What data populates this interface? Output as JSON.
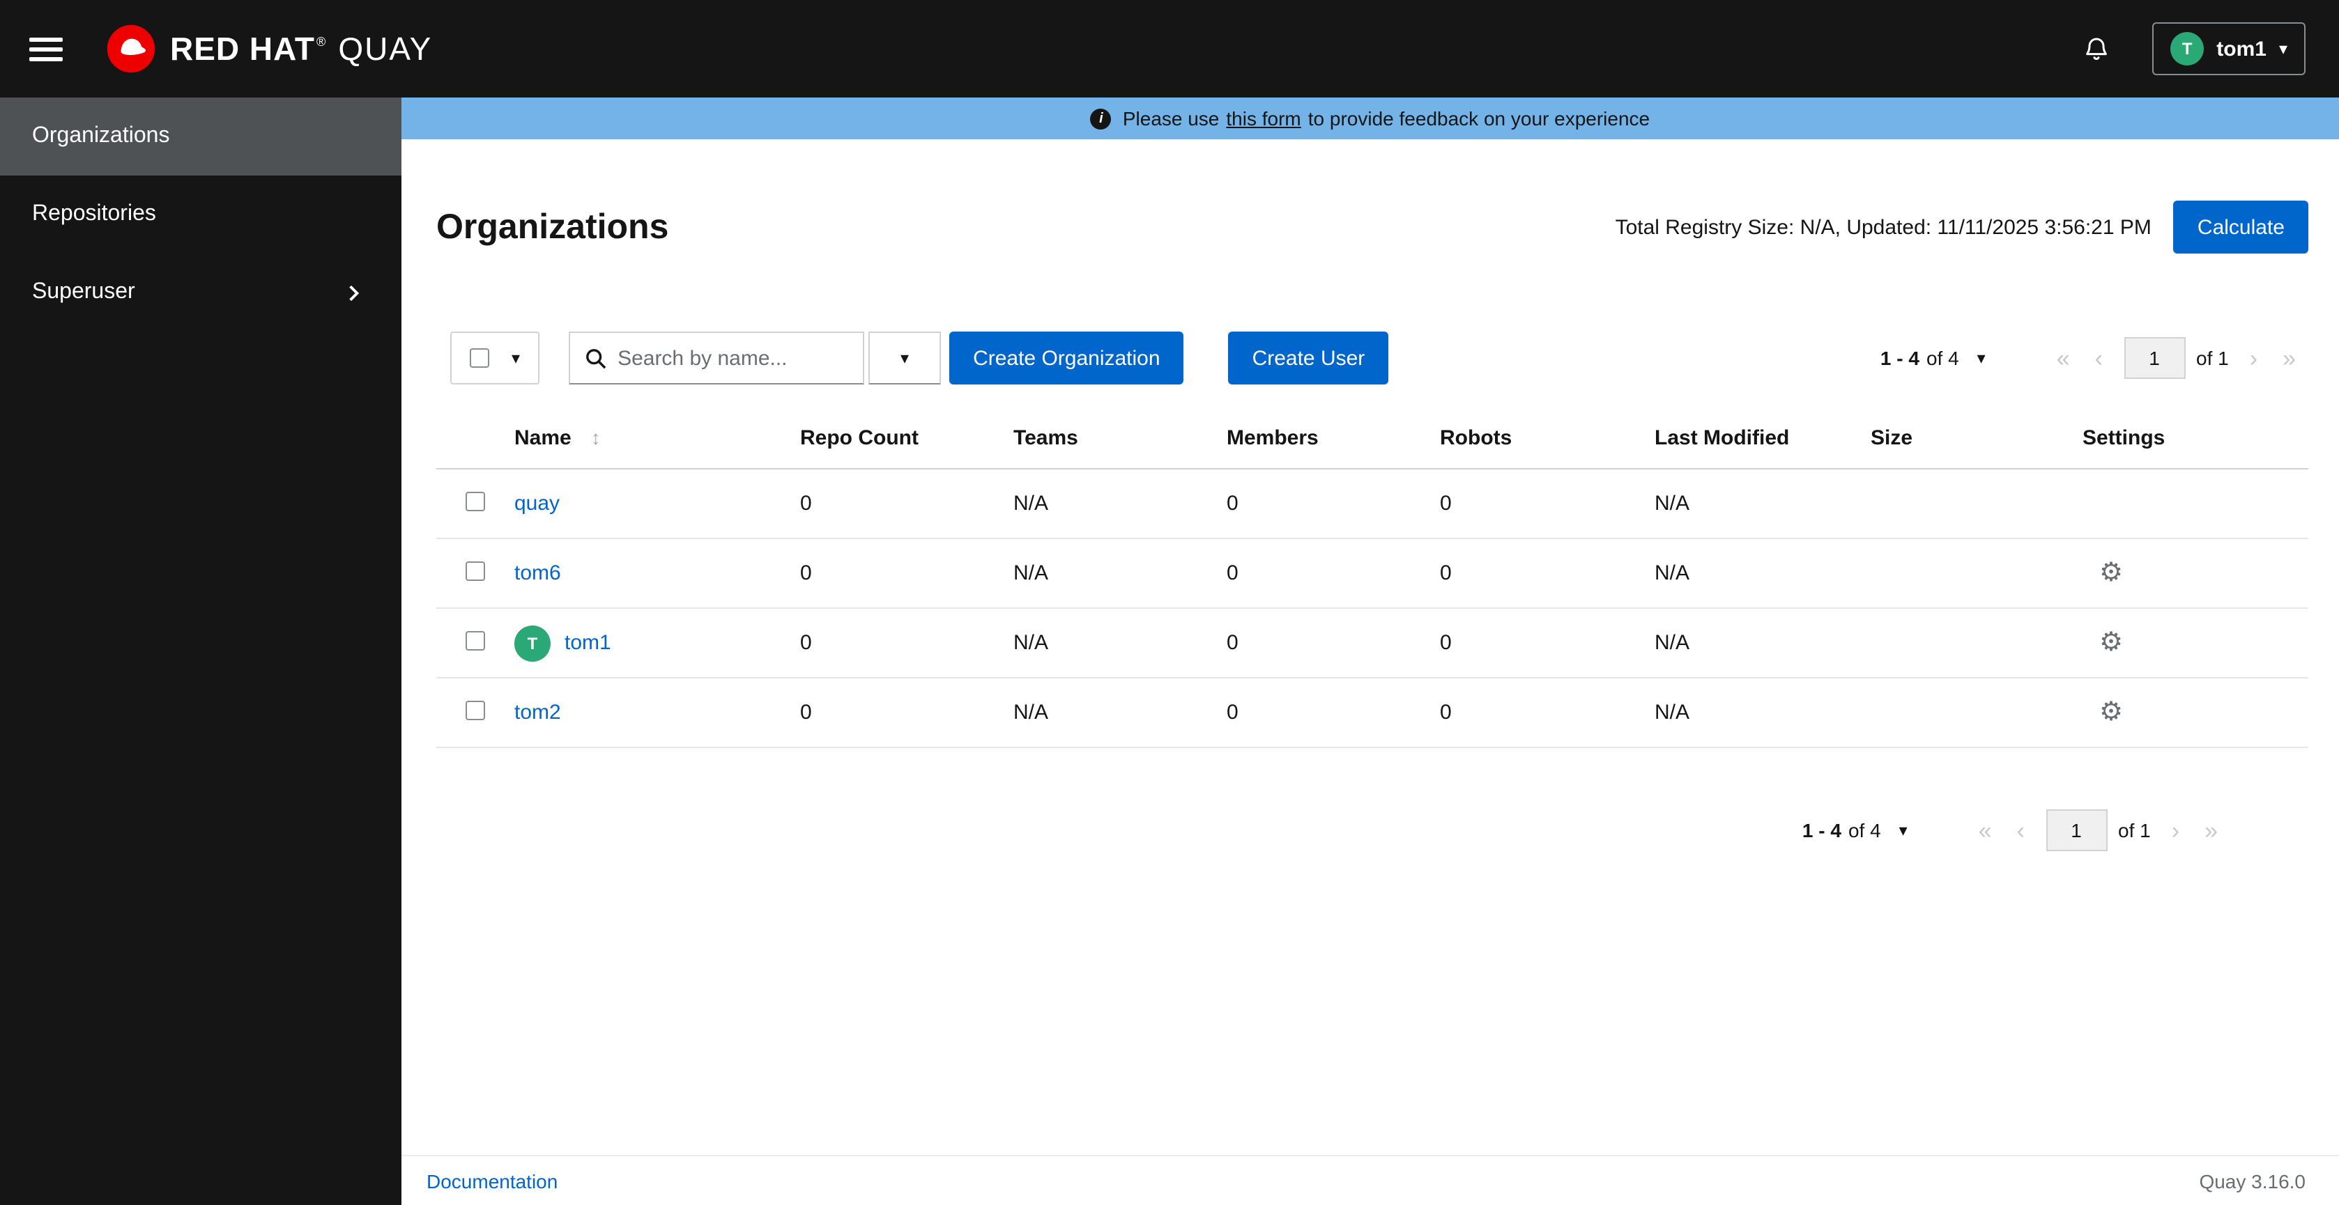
{
  "colors": {
    "primary_blue": "#0066cc",
    "banner_blue": "#73b3e7",
    "masthead_black": "#151515",
    "nav_selected_gray": "#4f5255",
    "avatar_green": "#2aa875",
    "logo_red": "#ee0000",
    "link_blue": "#0066cc"
  },
  "icons": {
    "caret_down": "▾",
    "sort": "↕",
    "gear": "⚙",
    "first_page": "«",
    "prev_page": "‹",
    "next_page": "›",
    "last_page": "»",
    "info": "i"
  },
  "masthead": {
    "brand_red_hat": "RED HAT",
    "brand_reg": "®",
    "brand_quay": "QUAY",
    "user_name": "tom1",
    "user_avatar_initial": "T"
  },
  "sidebar": {
    "items": [
      {
        "label": "Organizations",
        "selected": true
      },
      {
        "label": "Repositories",
        "selected": false
      },
      {
        "label": "Superuser",
        "selected": false,
        "expandable": true
      }
    ]
  },
  "banner": {
    "text_prefix": "Please use",
    "link_text": "this form",
    "text_suffix": "to provide feedback on your experience"
  },
  "page_header": {
    "title": "Organizations",
    "registry_info": "Total Registry Size: N/A, Updated: 11/11/2025 3:56:21 PM",
    "calculate_button": "Calculate"
  },
  "toolbar": {
    "search_placeholder": "Search by name...",
    "create_organization_button": "Create Organization",
    "create_user_button": "Create User"
  },
  "pagination": {
    "range": "1 - 4",
    "of_total": "of 4",
    "current_page": "1",
    "of_pages": "of 1"
  },
  "table": {
    "headers": [
      "Name",
      "Repo Count",
      "Teams",
      "Members",
      "Robots",
      "Last Modified",
      "Size",
      "Settings"
    ],
    "rows": [
      {
        "name": "quay",
        "repo_count": "0",
        "teams": "N/A",
        "members": "0",
        "robots": "0",
        "last_modified": "N/A",
        "size": "",
        "has_settings": false
      },
      {
        "name": "tom6",
        "repo_count": "0",
        "teams": "N/A",
        "members": "0",
        "robots": "0",
        "last_modified": "N/A",
        "size": "",
        "has_settings": true
      },
      {
        "name": "tom1",
        "avatar_initial": "T",
        "repo_count": "0",
        "teams": "N/A",
        "members": "0",
        "robots": "0",
        "last_modified": "N/A",
        "size": "",
        "has_settings": true
      },
      {
        "name": "tom2",
        "repo_count": "0",
        "teams": "N/A",
        "members": "0",
        "robots": "0",
        "last_modified": "N/A",
        "size": "",
        "has_settings": true
      }
    ]
  },
  "footer": {
    "documentation_link": "Documentation",
    "version": "Quay 3.16.0"
  }
}
